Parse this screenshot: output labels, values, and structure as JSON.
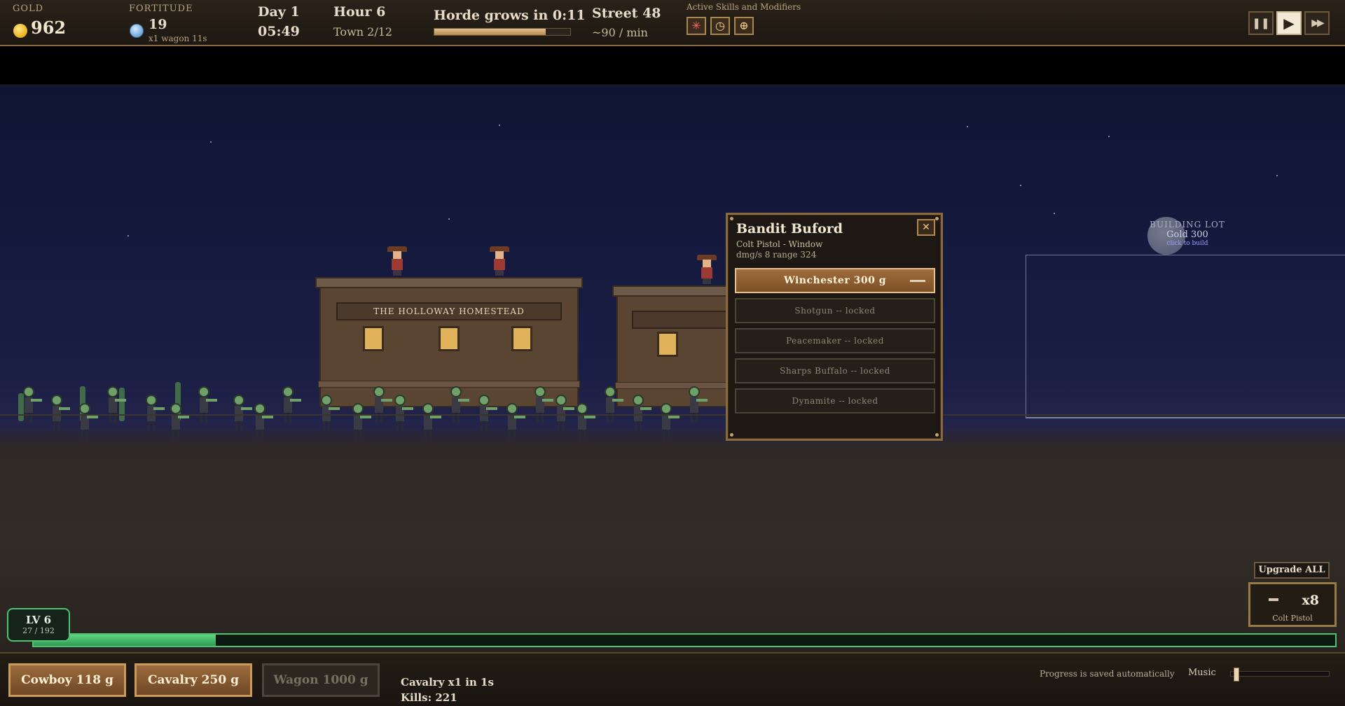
{
  "hud": {
    "gold_label": "GOLD",
    "gold_value": "962",
    "fortitude_label": "FORTITUDE",
    "fortitude_value": "19",
    "fortitude_sub": "x1 wagon  11s",
    "day": "Day 1",
    "clock": "05:49",
    "hour": "Hour 6",
    "town": "Town 2/12",
    "horde_text": "Horde grows in 0:11",
    "horde_progress": 0.82,
    "street": "Street  48",
    "rate": "~90 / min",
    "skills_label": "Active Skills and Modifiers",
    "skills": [
      {
        "icon": "star-burst-icon",
        "glyph": "✳"
      },
      {
        "icon": "stopwatch-icon",
        "glyph": "◷"
      },
      {
        "icon": "coin-plus-icon",
        "glyph": "⊕"
      }
    ],
    "controls": [
      {
        "name": "pause-button",
        "glyph": "❚❚",
        "active": false
      },
      {
        "name": "play-button",
        "glyph": "▶",
        "active": true
      },
      {
        "name": "fast-forward-button",
        "glyph": "▶▶",
        "active": false
      }
    ]
  },
  "scene": {
    "homestead_sign": "THE HOLLOWAY HOMESTEAD",
    "lot": {
      "label": "BUILDING LOT",
      "price": "Gold 300",
      "hint": "click to build"
    }
  },
  "popup": {
    "title": "Bandit Buford",
    "subtitle": "Colt Pistol  -  Window",
    "stats": "dmg/s 8    range 324",
    "close_glyph": "✕",
    "options": [
      {
        "label": "Winchester   300 g",
        "state": "buy"
      },
      {
        "label": "Shotgun -- locked",
        "state": "locked"
      },
      {
        "label": "Peacemaker -- locked",
        "state": "locked"
      },
      {
        "label": "Sharps Buffalo -- locked",
        "state": "locked"
      },
      {
        "label": "Dynamite -- locked",
        "state": "locked"
      }
    ]
  },
  "upgrades": {
    "upgrade_all": "Upgrade ALL",
    "colt_count": "x8",
    "colt_label": "Colt Pistol"
  },
  "level": {
    "label": "LV 6",
    "xp_text": "27 / 192",
    "xp_fraction": 0.14
  },
  "bottom": {
    "buttons": [
      {
        "label": "Cowboy   118 g",
        "enabled": true
      },
      {
        "label": "Cavalry   250 g",
        "enabled": true
      },
      {
        "label": "Wagon   1000 g",
        "enabled": false
      }
    ],
    "queue_text": "Cavalry x1 in 1s",
    "kills_text": "Kills: 221",
    "saved_text": "Progress is saved automatically",
    "music_label": "Music",
    "music_level": 0.03
  }
}
